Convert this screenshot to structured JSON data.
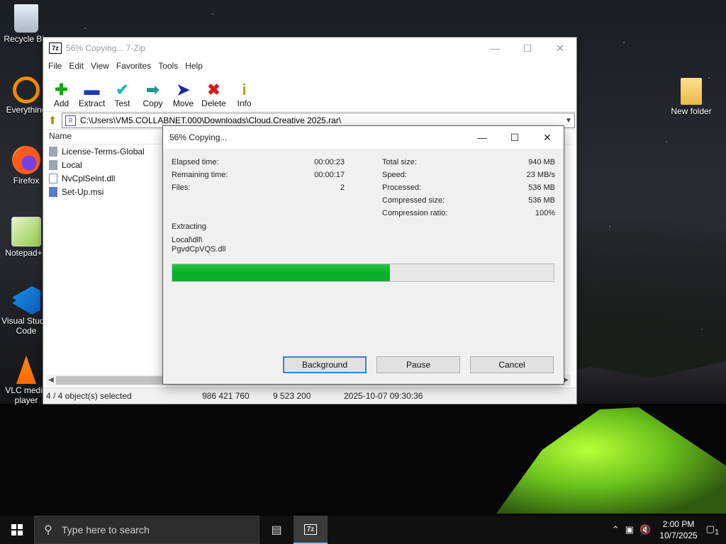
{
  "desktop": {
    "icons": [
      {
        "label": "Recycle Bin",
        "icon": "recycle-bin-icon"
      },
      {
        "label": "Everything",
        "icon": "everything-icon"
      },
      {
        "label": "Firefox",
        "icon": "firefox-icon"
      },
      {
        "label": "Notepad++",
        "icon": "notepad-plus-icon"
      },
      {
        "label": "Visual Studio Code",
        "icon": "vscode-icon"
      },
      {
        "label": "VLC media player",
        "icon": "vlc-icon"
      },
      {
        "label": "New folder",
        "icon": "folder-icon"
      }
    ]
  },
  "window": {
    "title": "56% Copying... 7-Zip",
    "app_icon": "7z",
    "menu": [
      "File",
      "Edit",
      "View",
      "Favorites",
      "Tools",
      "Help"
    ],
    "toolbar": [
      {
        "label": "Add",
        "icon": "plus-icon",
        "color": "#1aa31a"
      },
      {
        "label": "Extract",
        "icon": "minus-icon",
        "color": "#1a3ab8"
      },
      {
        "label": "Test",
        "icon": "check-icon",
        "color": "#1fb6c0"
      },
      {
        "label": "Copy",
        "icon": "copy-arrow-icon",
        "color": "#1a9a8a"
      },
      {
        "label": "Move",
        "icon": "move-arrow-icon",
        "color": "#1a2a9a"
      },
      {
        "label": "Delete",
        "icon": "delete-x-icon",
        "color": "#d41a1a"
      },
      {
        "label": "Info",
        "icon": "info-icon",
        "color": "#a8a800"
      }
    ],
    "address": "C:\\Users\\VM5.COLLABNET.000\\Downloads\\Cloud.Creative 2025.rar\\",
    "column_name": "Name",
    "files": [
      {
        "name": "License-Terms-Global",
        "type": "folder"
      },
      {
        "name": "Local",
        "type": "folder"
      },
      {
        "name": "NvCplSelnt.dll",
        "type": "dll"
      },
      {
        "name": "Set-Up.msi",
        "type": "msi"
      }
    ],
    "status": {
      "selected": "4 / 4 object(s) selected",
      "size": "986 421 760",
      "packed": "9 523 200",
      "modified": "2025-10-07 09:30:36"
    }
  },
  "dialog": {
    "title": "56% Copying...",
    "left": [
      {
        "label": "Elapsed time:",
        "value": "00:00:23"
      },
      {
        "label": "Remaining time:",
        "value": "00:00:17"
      },
      {
        "label": "Files:",
        "value": "2"
      }
    ],
    "right": [
      {
        "label": "Total size:",
        "value": "940 MB"
      },
      {
        "label": "Speed:",
        "value": "23 MB/s"
      },
      {
        "label": "Processed:",
        "value": "536 MB"
      },
      {
        "label": "Compressed size:",
        "value": "536 MB"
      },
      {
        "label": "Compression ratio:",
        "value": "100%"
      }
    ],
    "action": "Extracting",
    "current_path": "Local\\dll\\",
    "current_file": "PgvdCpVQS.dll",
    "progress": 0.57,
    "buttons": {
      "background": "Background",
      "pause": "Pause",
      "cancel": "Cancel"
    }
  },
  "taskbar": {
    "search_placeholder": "Type here to search",
    "active_app": "7z",
    "time": "2:00 PM",
    "date": "10/7/2025",
    "notifications": "1"
  }
}
